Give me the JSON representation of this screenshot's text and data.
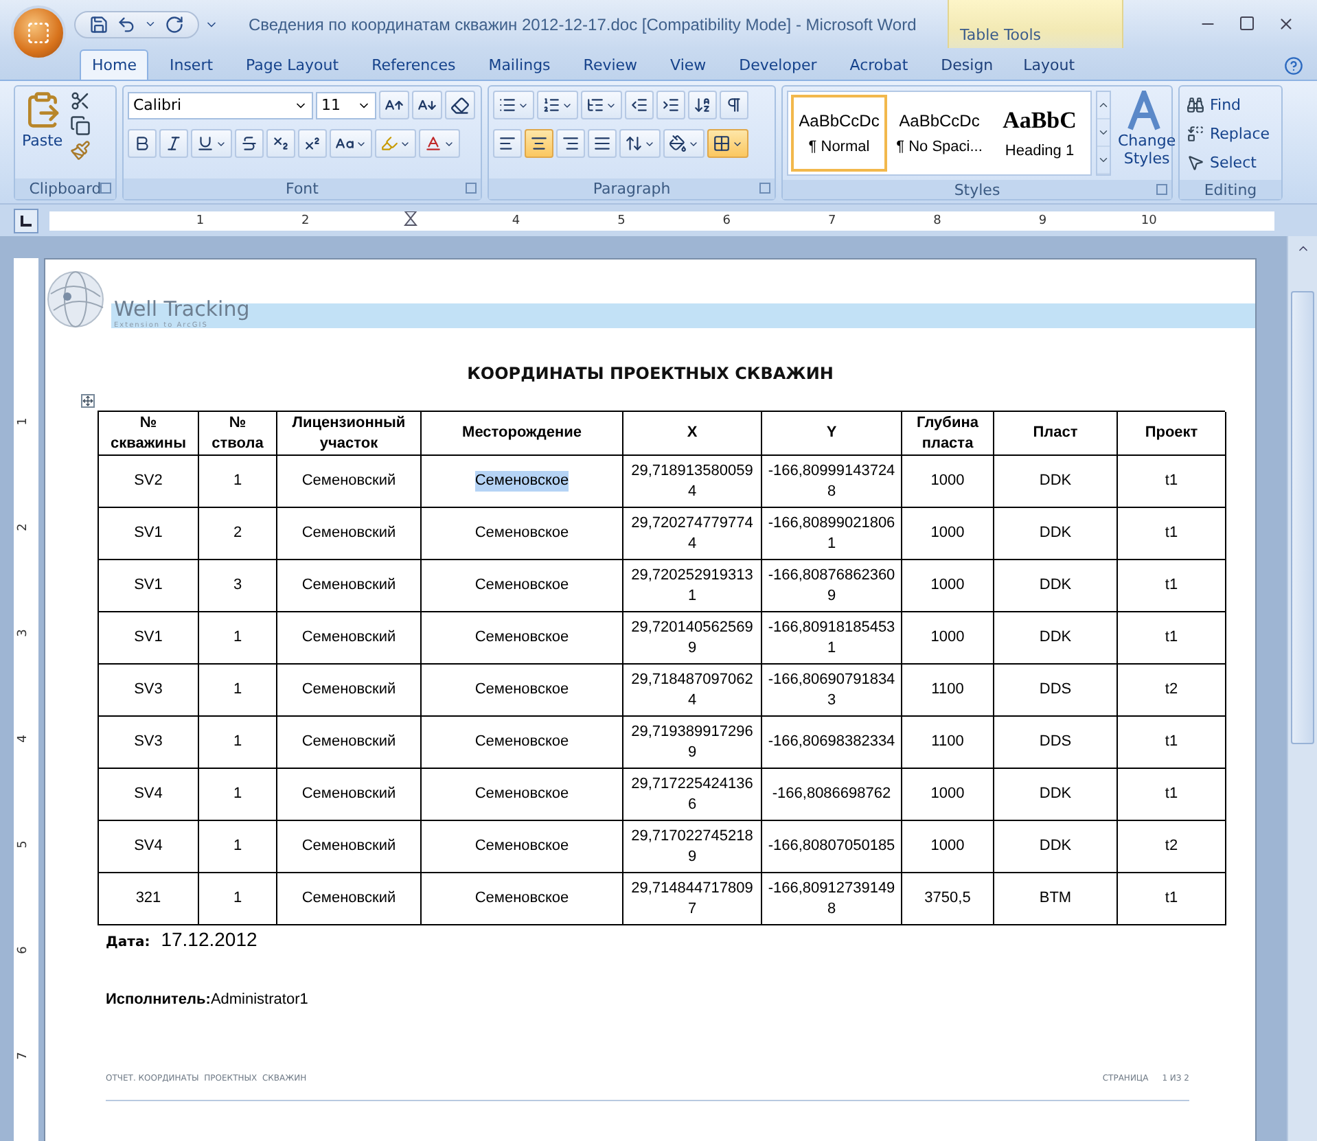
{
  "window": {
    "title": "Сведения по координатам скважин 2012-12-17.doc [Compatibility Mode] - Microsoft Word",
    "contextual_group": "Table Tools"
  },
  "tabs": [
    {
      "label": "Home",
      "selected": true,
      "contextual": false
    },
    {
      "label": "Insert",
      "selected": false,
      "contextual": false
    },
    {
      "label": "Page Layout",
      "selected": false,
      "contextual": false
    },
    {
      "label": "References",
      "selected": false,
      "contextual": false
    },
    {
      "label": "Mailings",
      "selected": false,
      "contextual": false
    },
    {
      "label": "Review",
      "selected": false,
      "contextual": false
    },
    {
      "label": "View",
      "selected": false,
      "contextual": false
    },
    {
      "label": "Developer",
      "selected": false,
      "contextual": false
    },
    {
      "label": "Acrobat",
      "selected": false,
      "contextual": false
    },
    {
      "label": "Design",
      "selected": false,
      "contextual": true
    },
    {
      "label": "Layout",
      "selected": false,
      "contextual": true
    }
  ],
  "ribbon": {
    "clipboard": {
      "title": "Clipboard",
      "paste": "Paste"
    },
    "font": {
      "title": "Font",
      "name": "Calibri",
      "size": "11"
    },
    "paragraph": {
      "title": "Paragraph",
      "align_buttons": [
        {
          "kind": "left",
          "selected": false
        },
        {
          "kind": "center",
          "selected": true
        },
        {
          "kind": "right",
          "selected": false
        },
        {
          "kind": "justify",
          "selected": false
        }
      ],
      "borders_selected": true
    },
    "styles": {
      "title": "Styles",
      "items": [
        {
          "preview": "AaBbCcDc",
          "label": "¶ Normal",
          "selected": true,
          "kind": "normal"
        },
        {
          "preview": "AaBbCcDc",
          "label": "¶ No Spaci...",
          "selected": false,
          "kind": "normal"
        },
        {
          "preview": "AaBbC",
          "label": "Heading 1",
          "selected": false,
          "kind": "heading"
        }
      ],
      "change_styles": [
        "Change",
        "Styles"
      ]
    },
    "editing": {
      "title": "Editing",
      "items": [
        {
          "kind": "find",
          "label": "Find"
        },
        {
          "kind": "replace",
          "label": "Replace"
        },
        {
          "kind": "select",
          "label": "Select"
        }
      ]
    }
  },
  "ruler": {
    "segments": [
      {
        "kind": "number",
        "label": "1"
      },
      {
        "kind": "number",
        "label": "2"
      },
      {
        "kind": "indent"
      },
      {
        "kind": "number",
        "label": "4"
      },
      {
        "kind": "number",
        "label": "5"
      },
      {
        "kind": "number",
        "label": "6"
      },
      {
        "kind": "number",
        "label": "7"
      },
      {
        "kind": "number",
        "label": "8"
      },
      {
        "kind": "number",
        "label": "9"
      },
      {
        "kind": "number",
        "label": "10"
      }
    ]
  },
  "vertical_ruler": [
    "1",
    "2",
    "3",
    "4",
    "5",
    "6",
    "7"
  ],
  "document": {
    "logo": {
      "name": "Well Tracking",
      "tagline": "Extension to ArcGIS"
    },
    "title": "КООРДИНАТЫ ПРОЕКТНЫХ СКВАЖИН",
    "table": {
      "columns": [
        "№ скважины",
        "№ ствола",
        "Лицензионный участок",
        "Месторождение",
        "X",
        "Y",
        "Глубина пласта",
        "Пласт",
        "Проект"
      ],
      "rows": [
        {
          "cells": [
            "SV2",
            "1",
            "Семеновский",
            "Семеновское",
            "29,7189135800594",
            "-166,809991437248",
            "1000",
            "DDK",
            "t1"
          ],
          "deposit_selected": true
        },
        {
          "cells": [
            "SV1",
            "2",
            "Семеновский",
            "Семеновское",
            "29,7202747797744",
            "-166,808990218061",
            "1000",
            "DDK",
            "t1"
          ],
          "deposit_selected": false
        },
        {
          "cells": [
            "SV1",
            "3",
            "Семеновский",
            "Семеновское",
            "29,7202529193131",
            "-166,808768623609",
            "1000",
            "DDK",
            "t1"
          ],
          "deposit_selected": false
        },
        {
          "cells": [
            "SV1",
            "1",
            "Семеновский",
            "Семеновское",
            "29,7201405625699",
            "-166,809181854531",
            "1000",
            "DDK",
            "t1"
          ],
          "deposit_selected": false
        },
        {
          "cells": [
            "SV3",
            "1",
            "Семеновский",
            "Семеновское",
            "29,7184870970624",
            "-166,806907918343",
            "1100",
            "DDS",
            "t2"
          ],
          "deposit_selected": false
        },
        {
          "cells": [
            "SV3",
            "1",
            "Семеновский",
            "Семеновское",
            "29,7193899172969",
            "-166,80698382334",
            "1100",
            "DDS",
            "t1"
          ],
          "deposit_selected": false
        },
        {
          "cells": [
            "SV4",
            "1",
            "Семеновский",
            "Семеновское",
            "29,7172254241366",
            "-166,8086698762",
            "1000",
            "DDK",
            "t1"
          ],
          "deposit_selected": false
        },
        {
          "cells": [
            "SV4",
            "1",
            "Семеновский",
            "Семеновское",
            "29,7170227452189",
            "-166,80807050185",
            "1000",
            "DDK",
            "t2"
          ],
          "deposit_selected": false
        },
        {
          "cells": [
            "321",
            "1",
            "Семеновский",
            "Семеновское",
            "29,7148447178097",
            "-166,809127391498",
            "3750,5",
            "BTM",
            "t1"
          ],
          "deposit_selected": false
        }
      ]
    },
    "date_label": "Дата:",
    "date": "17.12.2012",
    "executor": "**Исполнитель:**Administrator1",
    "footer": {
      "left": "ОТЧЕТ. КООРДИНАТЫ  ПРОЕКТНЫХ  СКВАЖИН",
      "page_label": "СТРАНИЦА",
      "page": "1 ИЗ 2"
    }
  }
}
